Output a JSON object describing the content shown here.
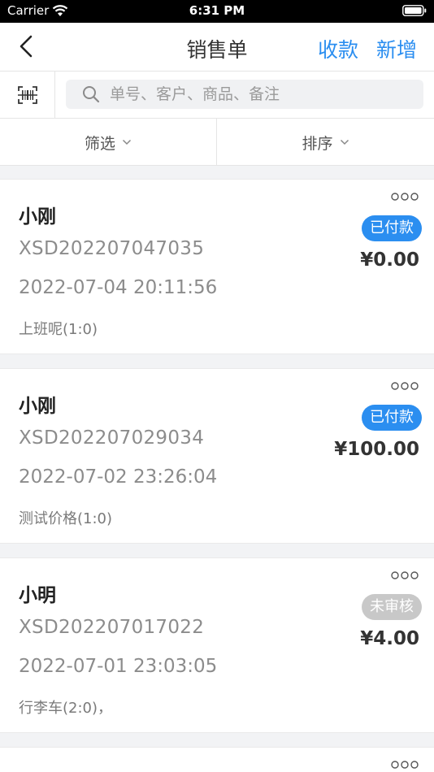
{
  "status_bar": {
    "carrier": "Carrier",
    "time": "6:31 PM"
  },
  "nav": {
    "title": "销售单",
    "collect_label": "收款",
    "add_label": "新增"
  },
  "search": {
    "placeholder": "单号、客户、商品、备注",
    "value": ""
  },
  "filters": {
    "filter_label": "筛选",
    "sort_label": "排序"
  },
  "colors": {
    "accent": "#2b8ef0",
    "pending": "#c8c8c8"
  },
  "orders": [
    {
      "customer": "小刚",
      "order_no": "XSD202207047035",
      "datetime": "2022-07-04 20:11:56",
      "note": "上班呢(1:0)",
      "status": "已付款",
      "amount": "¥0.00"
    },
    {
      "customer": "小刚",
      "order_no": "XSD202207029034",
      "datetime": "2022-07-02 23:26:04",
      "note": "测试价格(1:0)",
      "status": "已付款",
      "amount": "¥100.00"
    },
    {
      "customer": "小明",
      "order_no": "XSD202207017022",
      "datetime": "2022-07-01 23:03:05",
      "note": "行李车(2:0)，",
      "status": "未审核",
      "amount": "¥4.00"
    }
  ]
}
